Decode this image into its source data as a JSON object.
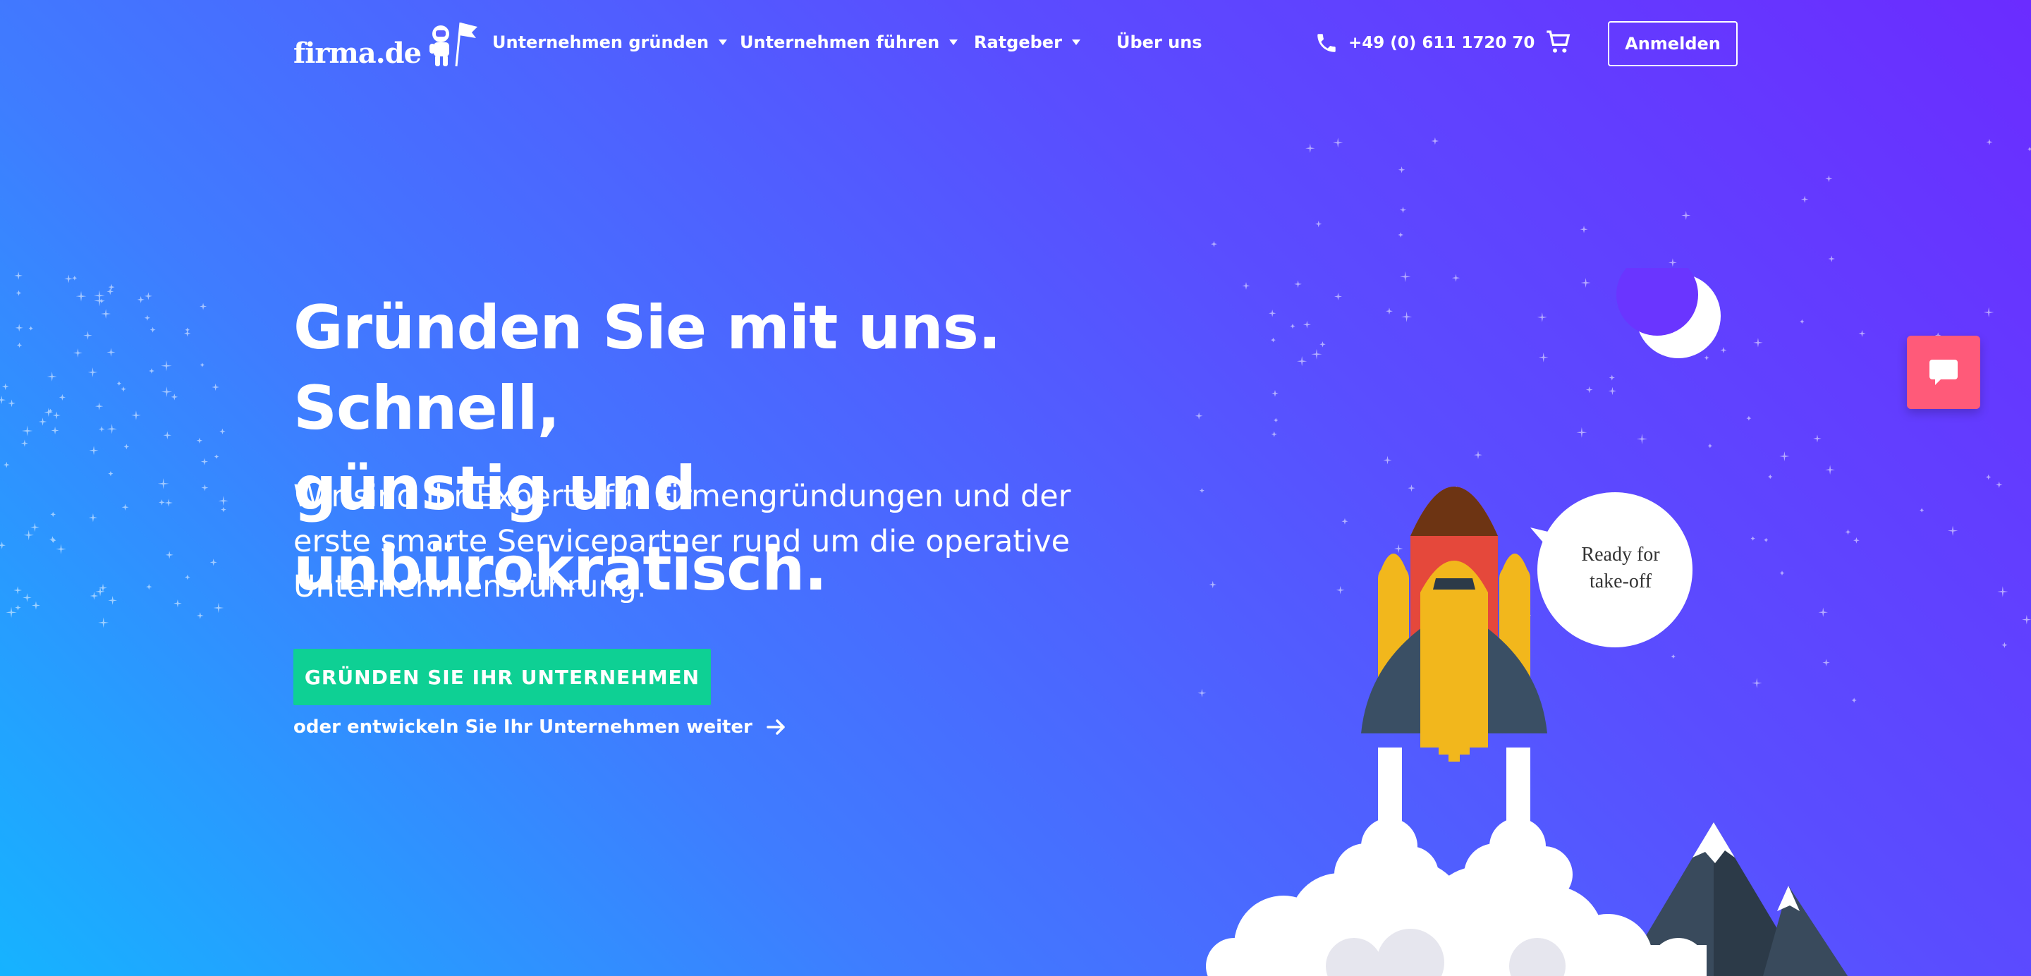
{
  "brand": {
    "logo_text": "firma.de"
  },
  "nav": {
    "items": [
      {
        "label": "Unternehmen gründen",
        "has_dropdown": true
      },
      {
        "label": "Unternehmen führen",
        "has_dropdown": true
      },
      {
        "label": "Ratgeber",
        "has_dropdown": true
      },
      {
        "label": "Über uns",
        "has_dropdown": false
      }
    ],
    "phone": "+49 (0) 611 1720 70",
    "login_label": "Anmelden"
  },
  "hero": {
    "headline_line1": "Gründen Sie mit uns. Schnell,",
    "headline_line2": "günstig und unbürokratisch.",
    "sub_line1": "Wir sind Ihr Experte für Firmengründungen und der",
    "sub_line2": "erste smarte Servicepartner rund um die operative",
    "sub_line3": "Unternehmensführung.",
    "cta_label": "GRÜNDEN SIE IHR UNTERNEHMEN",
    "secondary_link": "oder entwickeln Sie Ihr Unternehmen weiter"
  },
  "illustration": {
    "bubble_line1": "Ready for",
    "bubble_line2": "take-off"
  },
  "colors": {
    "cta_green": "#0ed094",
    "chat_pink": "#ff5a79",
    "gradient_start": "#16b3ff",
    "gradient_end": "#6b2cff"
  }
}
